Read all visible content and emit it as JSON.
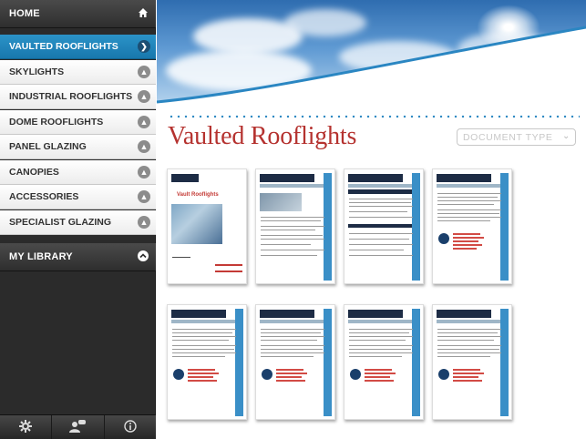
{
  "sidebar": {
    "home_label": "HOME",
    "items": [
      {
        "label": "VAULTED ROOFLIGHTS",
        "active": true,
        "icon": "chevron-right-icon"
      },
      {
        "label": "SKYLIGHTS",
        "active": false,
        "icon": "chevron-up-icon"
      },
      {
        "label": "INDUSTRIAL ROOFLIGHTS",
        "active": false,
        "icon": "chevron-up-icon"
      },
      {
        "label": "DOME ROOFLIGHTS",
        "active": false,
        "icon": "chevron-up-icon"
      },
      {
        "label": "PANEL GLAZING",
        "active": false,
        "icon": "chevron-up-icon"
      },
      {
        "label": "CANOPIES",
        "active": false,
        "icon": "chevron-up-icon"
      },
      {
        "label": "ACCESSORIES",
        "active": false,
        "icon": "chevron-up-icon"
      },
      {
        "label": "SPECIALIST GLAZING",
        "active": false,
        "icon": "chevron-up-icon"
      }
    ],
    "library_label": "MY LIBRARY",
    "footer_icons": [
      "gear-icon",
      "profile-chat-icon",
      "info-icon"
    ]
  },
  "main": {
    "title": "Vaulted Rooflights",
    "document_type_label": "DOCUMENT TYPE",
    "cover_title": "Vault Rooflights"
  },
  "colors": {
    "accent_blue": "#1f86be",
    "title_red": "#b5322f",
    "sidebar_dark": "#2b2b2b"
  }
}
